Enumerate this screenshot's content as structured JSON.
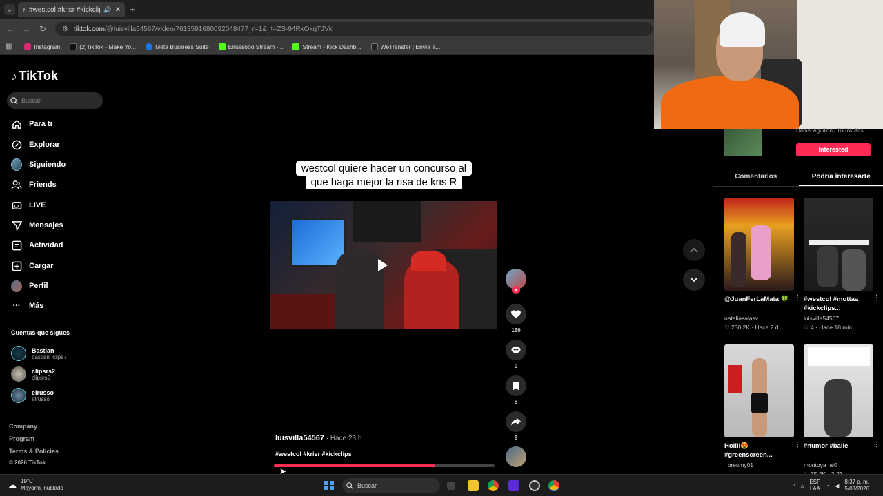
{
  "browser": {
    "tab_title": "#westcol #krisr #kickclips",
    "url_host": "tiktok.com",
    "url_path": "/@luisvilla54567/video/7613591680092048477_r=1&_t=ZS-94RxOkqTJVk",
    "bookmarks": [
      "Instagram",
      "(2)TikTok - Make Yo...",
      "Meta Business Suite",
      "Elrussooo Stream -...",
      "Stream - Kick Dashb...",
      "WeTransfer | Envía a..."
    ]
  },
  "sidebar": {
    "logo": "TikTok",
    "search_placeholder": "Buscar",
    "nav": [
      "Para ti",
      "Explorar",
      "Siguiendo",
      "Friends",
      "LIVE",
      "Mensajes",
      "Actividad",
      "Cargar",
      "Perfil",
      "Más"
    ],
    "following_title": "Cuentas que sigues",
    "following": [
      {
        "name": "Bastian",
        "handle": "bastian_clips7"
      },
      {
        "name": "clipsrs2",
        "handle": "clipsrs2"
      },
      {
        "name": "elrusso____",
        "handle": "elrusso____"
      }
    ],
    "footer": [
      "Company",
      "Program",
      "Terms & Policies",
      "© 2026 TikTok"
    ]
  },
  "video": {
    "caption_line1": "westcol quiere hacer un concurso al",
    "caption_line2": "que haga mejor la risa de kris R",
    "username": "luisvilla54567",
    "time": " · Hace 23 h",
    "hashtags": "#westcol #krisr #kickclips",
    "progress": 0.73,
    "likes": "160",
    "comments": "0",
    "saves": "8",
    "shares": "9"
  },
  "right_panel": {
    "ad_brand": "Daniel Aguillon | TikTok Ads",
    "interest_button": "Interested",
    "tab_comments": "Comentarios",
    "tab_interest": "Podría interesarte",
    "cards": [
      {
        "title": "@JuanFerLaMata 🍀",
        "user": "nataliasalasv",
        "stats": "♡ 230.2K · Hace 2 d"
      },
      {
        "title": "#westcol #mottaa #kickclips...",
        "user": "luisvilla54567",
        "stats": "♡ 4 · Hace 18 min"
      },
      {
        "title": "Holiii😍 #greenscreen...",
        "user": "_bresmy01",
        "stats": ""
      },
      {
        "title": "#humor #baile",
        "user": "montoya_al0",
        "stats": "♡ 75.2K · 2-23"
      }
    ]
  },
  "taskbar": {
    "temp": "19°C",
    "weather": "Mayorm. nublado",
    "search": "Buscar",
    "lang1": "ESP",
    "lang2": "LAA",
    "time": "8:37 p. m.",
    "date": "5/03/2026"
  },
  "colors": {
    "accent": "#fe2c55",
    "background": "#000000"
  }
}
